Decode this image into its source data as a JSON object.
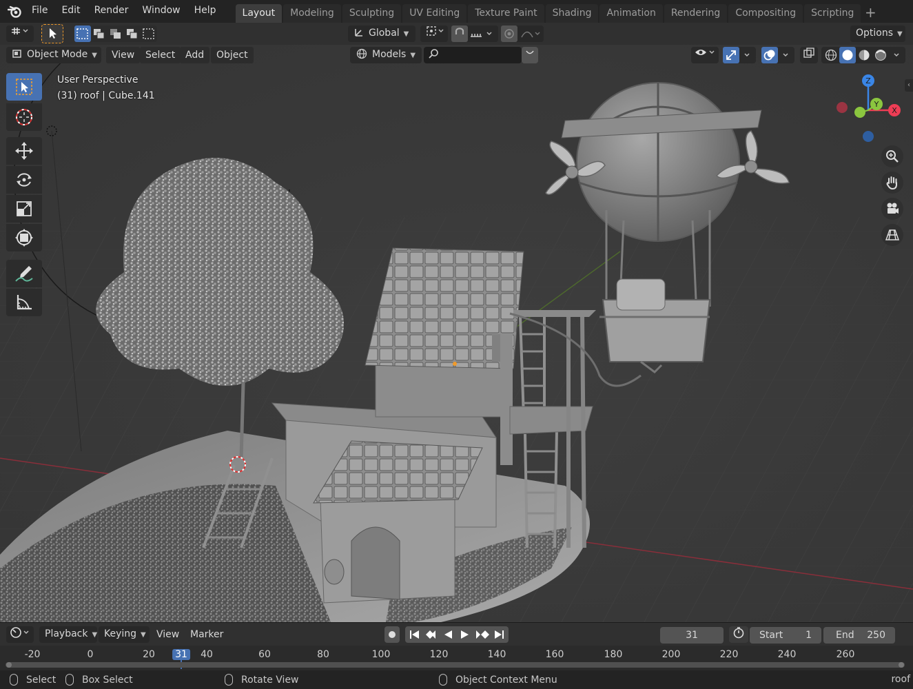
{
  "menubar": {
    "items": [
      "File",
      "Edit",
      "Render",
      "Window",
      "Help"
    ],
    "workspaces": [
      "Layout",
      "Modeling",
      "Sculpting",
      "UV Editing",
      "Texture Paint",
      "Shading",
      "Animation",
      "Rendering",
      "Compositing",
      "Scripting"
    ],
    "active_workspace": "Layout"
  },
  "tool_header": {
    "orientation": "Global",
    "options_label": "Options"
  },
  "view_header": {
    "mode": "Object Mode",
    "menus": [
      "View",
      "Select",
      "Add",
      "Object"
    ],
    "collection": "Models",
    "search_placeholder": ""
  },
  "viewport": {
    "perspective": "User Perspective",
    "object_info": "(31) roof | Cube.141",
    "gizmo_axes": [
      "Z",
      "Y",
      "X"
    ],
    "colors": {
      "x": "#ee3d55",
      "y": "#8bc63f",
      "z": "#3a86e7",
      "accent": "#4772b3"
    }
  },
  "tools": [
    "select-box",
    "cursor",
    "move",
    "rotate",
    "scale",
    "transform",
    "annotate",
    "measure"
  ],
  "timeline": {
    "menus": [
      "Playback",
      "Keying",
      "View",
      "Marker"
    ],
    "current_frame": "31",
    "start_label": "Start",
    "start_value": "1",
    "end_label": "End",
    "end_value": "250",
    "ruler_ticks": [
      "-20",
      "0",
      "20",
      "31",
      "40",
      "60",
      "80",
      "100",
      "120",
      "140",
      "160",
      "180",
      "200",
      "220",
      "240",
      "260"
    ]
  },
  "statusbar": {
    "select": "Select",
    "box_select": "Box Select",
    "rotate_view": "Rotate View",
    "context_menu": "Object Context Menu",
    "active_object": "roof"
  }
}
